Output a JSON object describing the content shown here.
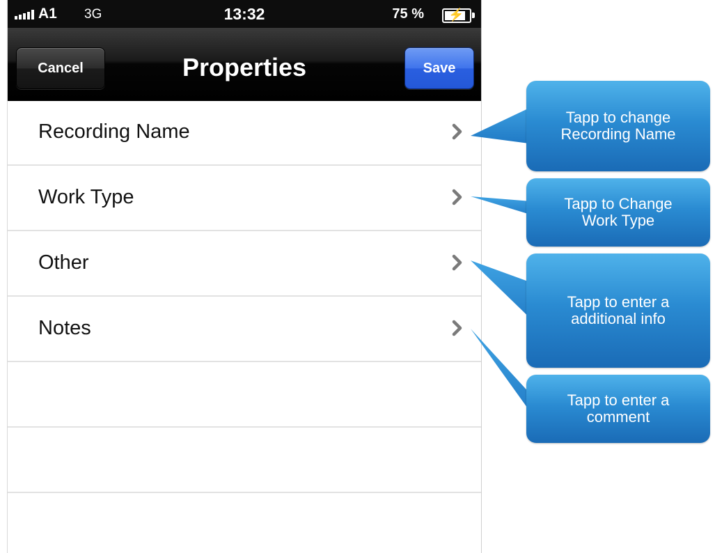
{
  "status_bar": {
    "carrier": "A1",
    "network": "3G",
    "time": "13:32",
    "battery": "75 %"
  },
  "nav": {
    "title": "Properties",
    "cancel_label": "Cancel",
    "save_label": "Save"
  },
  "rows": [
    {
      "label": "Recording Name"
    },
    {
      "label": "Work Type"
    },
    {
      "label": "Other"
    },
    {
      "label": "Notes"
    },
    {
      "label": ""
    },
    {
      "label": ""
    },
    {
      "label": ""
    }
  ],
  "callouts": [
    {
      "text": "Tapp to change\nRecording Name"
    },
    {
      "text": "Tapp to Change\nWork Type"
    },
    {
      "text": "Tapp to enter a\nadditional info"
    },
    {
      "text": "Tapp to enter a\ncomment"
    }
  ],
  "colors": {
    "callout": "#2a8bd2",
    "save_button": "#3f74ec",
    "nav_bar": "#000000"
  },
  "icons": {
    "row_accessory": "chevron-right-icon"
  }
}
